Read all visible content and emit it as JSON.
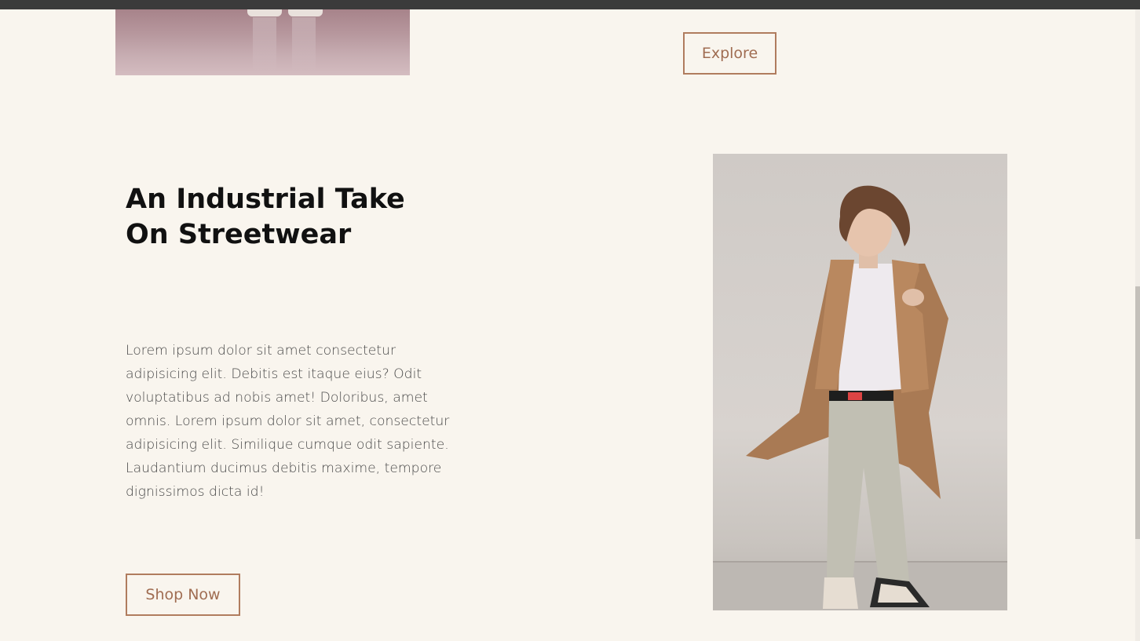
{
  "top_section": {
    "explore_label": "Explore"
  },
  "feature": {
    "headline_line1": "An Industrial Take",
    "headline_line2": "On Streetwear",
    "body": "Lorem ipsum dolor sit amet consectetur adipisicing elit. Debitis est itaque eius? Odit voluptatibus ad nobis amet! Doloribus, amet omnis. Lorem ipsum dolor sit amet, consectetur adipisicing elit. Similique cumque odit sapiente. Laudantium ducimus debitis maxime, tempore dignissimos dicta id!",
    "shop_label": "Shop Now"
  },
  "colors": {
    "page_background": "#f9f5ee",
    "accent": "#b07c5e",
    "button_text": "#a06d52",
    "headline": "#111111"
  }
}
